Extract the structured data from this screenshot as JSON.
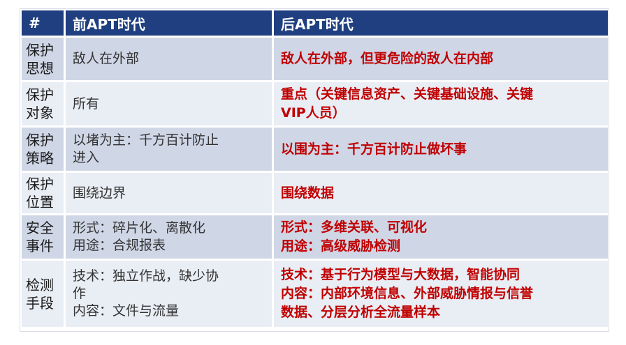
{
  "header": {
    "col_index": "#",
    "col_pre": "前APT时代",
    "col_post": "后APT时代"
  },
  "rows": [
    {
      "label": [
        "保护",
        "思想"
      ],
      "pre": [
        "敌人在外部"
      ],
      "post": [
        "敌人在外部，但更危险的敌人在内部"
      ]
    },
    {
      "label": [
        "保护",
        "对象"
      ],
      "pre": [
        "所有"
      ],
      "post": [
        "重点（关键信息资产、关键基础设施、关键",
        "VIP人员）"
      ]
    },
    {
      "label": [
        "保护",
        "策略"
      ],
      "pre": [
        "以堵为主：千方百计防止",
        "进入"
      ],
      "post": [
        "以围为主：千方百计防止做坏事"
      ]
    },
    {
      "label": [
        "保护",
        "位置"
      ],
      "pre": [
        "围绕边界"
      ],
      "post": [
        "围绕数据"
      ]
    },
    {
      "label": [
        "安全",
        "事件"
      ],
      "pre": [
        "形式：碎片化、离散化",
        "用途：合规报表"
      ],
      "post": [
        "形式：多维关联、可视化",
        "用途：高级威胁检测"
      ]
    },
    {
      "label": [
        "检测",
        "手段"
      ],
      "pre": [
        "技术：独立作战，缺少协",
        "作",
        "内容：文件与流量"
      ],
      "post": [
        "技术：基于行为模型与大数据，智能协同",
        "内容：内部环境信息、外部威胁情报与信誉",
        "数据、分层分析全流量样本"
      ]
    }
  ]
}
